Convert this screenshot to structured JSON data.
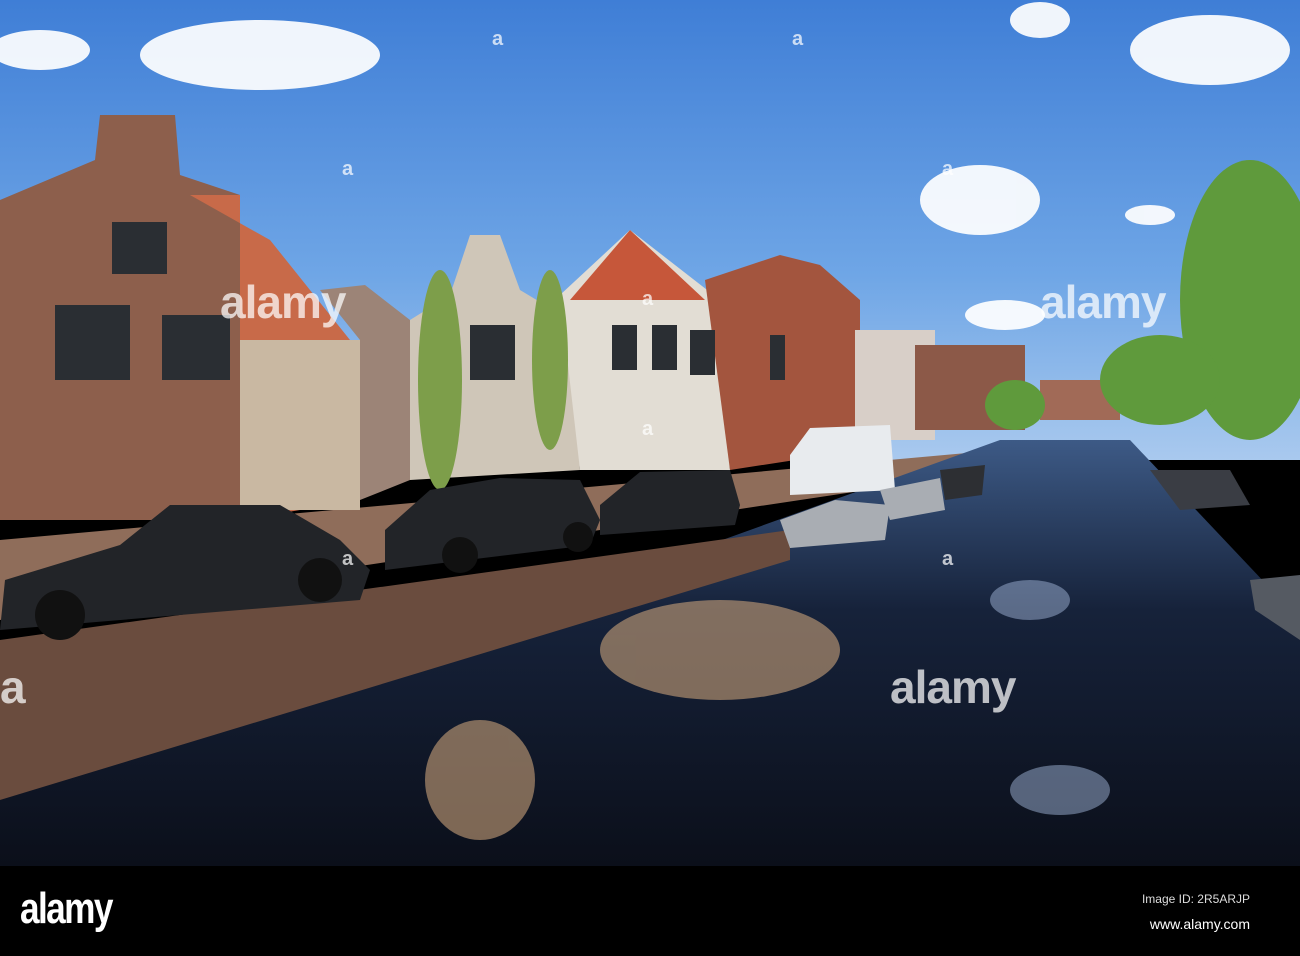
{
  "photo": {
    "subject": "Canal with gabled houses, parked cars and moored boats"
  },
  "watermarks": [
    "alamy",
    "alamy",
    "alamy",
    "a",
    "a",
    "a",
    "a",
    "a",
    "a",
    "a",
    "a",
    "a"
  ],
  "footer": {
    "logo": "alamy",
    "image_id": "Image ID: 2R5ARJP",
    "url": "www.alamy.com"
  }
}
